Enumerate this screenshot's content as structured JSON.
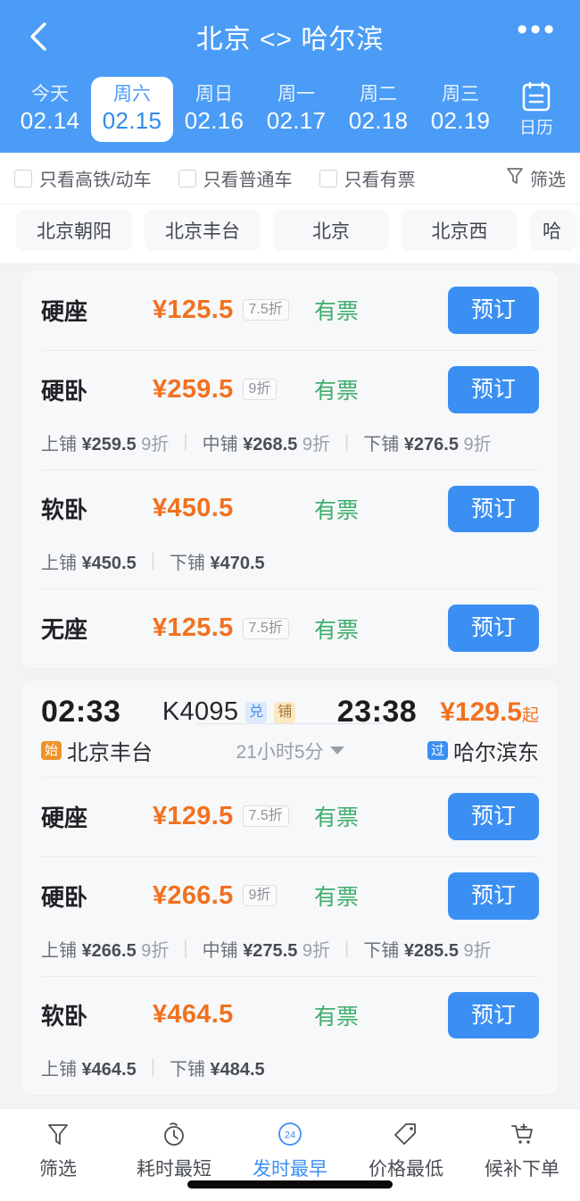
{
  "header": {
    "title": "北京 <> 哈尔滨",
    "back_icon": "chevron-left-icon",
    "more_icon": "more-horizontal-icon",
    "calendar": {
      "icon": "calendar-icon",
      "label": "日历"
    },
    "dates": [
      {
        "dow": "今天",
        "date": "02.14",
        "active": false
      },
      {
        "dow": "周六",
        "date": "02.15",
        "active": true
      },
      {
        "dow": "周日",
        "date": "02.16",
        "active": false
      },
      {
        "dow": "周一",
        "date": "02.17",
        "active": false
      },
      {
        "dow": "周二",
        "date": "02.18",
        "active": false
      },
      {
        "dow": "周三",
        "date": "02.19",
        "active": false
      }
    ]
  },
  "filters": {
    "checkboxes": [
      {
        "label": "只看高铁/动车",
        "checked": false
      },
      {
        "label": "只看普通车",
        "checked": false
      },
      {
        "label": "只看有票",
        "checked": false
      }
    ],
    "filter_link": {
      "label": "筛选",
      "icon": "filter-funnel-icon"
    },
    "stations": [
      "北京朝阳",
      "北京丰台",
      "北京",
      "北京西",
      "哈"
    ]
  },
  "cards": [
    {
      "id": "card-partial-top",
      "show_train_head": false,
      "seats": [
        {
          "name": "硬座",
          "price": "¥125.5",
          "discount": "7.5折",
          "status": "有票",
          "book_label": "预订",
          "berths": []
        },
        {
          "name": "硬卧",
          "price": "¥259.5",
          "discount": "9折",
          "status": "有票",
          "book_label": "预订",
          "berths": [
            {
              "name": "上铺",
              "price": "¥259.5",
              "discount": "9折"
            },
            {
              "name": "中铺",
              "price": "¥268.5",
              "discount": "9折"
            },
            {
              "name": "下铺",
              "price": "¥276.5",
              "discount": "9折"
            }
          ]
        },
        {
          "name": "软卧",
          "price": "¥450.5",
          "discount": "",
          "status": "有票",
          "book_label": "预订",
          "berths": [
            {
              "name": "上铺",
              "price": "¥450.5",
              "discount": ""
            },
            {
              "name": "下铺",
              "price": "¥470.5",
              "discount": ""
            }
          ]
        },
        {
          "name": "无座",
          "price": "¥125.5",
          "discount": "7.5折",
          "status": "有票",
          "book_label": "预订",
          "berths": []
        }
      ]
    },
    {
      "id": "card-k4095",
      "show_train_head": true,
      "train": {
        "depart_time": "02:33",
        "arrive_time": "23:38",
        "code": "K4095",
        "badges": [
          {
            "text": "兑",
            "kind": "dui"
          },
          {
            "text": "铺",
            "kind": "pu"
          }
        ],
        "from_station": "北京丰台",
        "from_tag": "始",
        "to_station": "哈尔滨东",
        "to_tag": "过",
        "duration": "21小时5分",
        "price_from": "¥129.5",
        "price_suffix": "起"
      },
      "seats": [
        {
          "name": "硬座",
          "price": "¥129.5",
          "discount": "7.5折",
          "status": "有票",
          "book_label": "预订",
          "berths": []
        },
        {
          "name": "硬卧",
          "price": "¥266.5",
          "discount": "9折",
          "status": "有票",
          "book_label": "预订",
          "berths": [
            {
              "name": "上铺",
              "price": "¥266.5",
              "discount": "9折"
            },
            {
              "name": "中铺",
              "price": "¥275.5",
              "discount": "9折"
            },
            {
              "name": "下铺",
              "price": "¥285.5",
              "discount": "9折"
            }
          ]
        },
        {
          "name": "软卧",
          "price": "¥464.5",
          "discount": "",
          "status": "有票",
          "book_label": "预订",
          "berths": [
            {
              "name": "上铺",
              "price": "¥464.5",
              "discount": ""
            },
            {
              "name": "下铺",
              "price": "¥484.5",
              "discount": ""
            }
          ]
        }
      ]
    }
  ],
  "bottom_bar": [
    {
      "label": "筛选",
      "icon": "filter-funnel-icon",
      "active": false
    },
    {
      "label": "耗时最短",
      "icon": "stopwatch-icon",
      "active": false
    },
    {
      "label": "发时最早",
      "icon": "clock-24-icon",
      "active": true
    },
    {
      "label": "价格最低",
      "icon": "price-tag-icon",
      "active": false
    },
    {
      "label": "候补下单",
      "icon": "cart-plus-icon",
      "active": false
    }
  ],
  "colors": {
    "brand_blue": "#4a9cf6",
    "button_blue": "#3b8ff3",
    "price_orange": "#f2711f",
    "status_green": "#3fae6d",
    "page_bg": "#f2f3f5",
    "card_bg": "#f7f8fa"
  }
}
